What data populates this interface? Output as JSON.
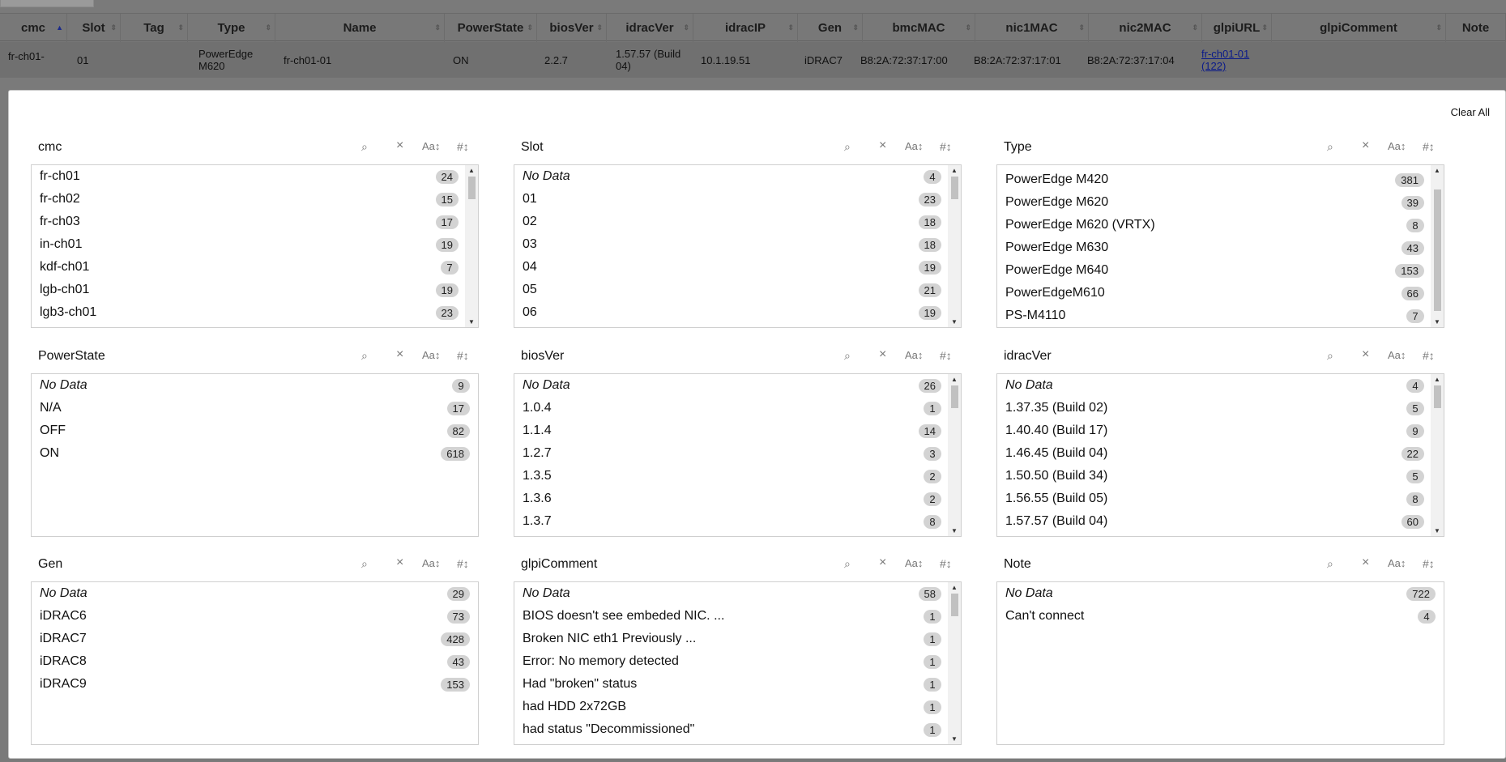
{
  "background_table": {
    "headers": [
      "cmc",
      "Slot",
      "Tag",
      "Type",
      "Name",
      "PowerState",
      "biosVer",
      "idracVer",
      "idracIP",
      "Gen",
      "bmcMAC",
      "nic1MAC",
      "nic2MAC",
      "glpiURL",
      "glpiComment",
      "Note"
    ],
    "sort_up_glyph": "▲",
    "sort_glyph": "⇕",
    "row": {
      "cmc": "fr-ch01-",
      "slot": "01",
      "tag": "",
      "type": "PowerEdge M620",
      "name": "fr-ch01-01",
      "powerstate": "ON",
      "biosver": "2.2.7",
      "idracver": "1.57.57 (Build 04)",
      "idracip": "10.1.19.51",
      "gen": "iDRAC7",
      "bmcmac": "B8:2A:72:37:17:00",
      "nic1mac": "B8:2A:72:37:17:01",
      "nic2mac": "B8:2A:72:37:17:04",
      "glpiurl": "fr-ch01-01 (122)",
      "glpicomment": "",
      "note": ""
    }
  },
  "modal": {
    "clear_all": "Clear All",
    "controls": {
      "search": "⌕",
      "clear": "×",
      "alpha_sort": "Aa↕",
      "num_sort": "#↕"
    },
    "scroll_up": "▲",
    "scroll_down": "▼",
    "panels": [
      {
        "title": "cmc",
        "has_scroll": true,
        "items": [
          {
            "label": "fr-ch01",
            "count": "24"
          },
          {
            "label": "fr-ch02",
            "count": "15"
          },
          {
            "label": "fr-ch03",
            "count": "17"
          },
          {
            "label": "in-ch01",
            "count": "19"
          },
          {
            "label": "kdf-ch01",
            "count": "7"
          },
          {
            "label": "lgb-ch01",
            "count": "19"
          },
          {
            "label": "lgb3-ch01",
            "count": "23"
          }
        ]
      },
      {
        "title": "Slot",
        "has_scroll": true,
        "items": [
          {
            "label": "No Data",
            "count": "4",
            "nodata": true
          },
          {
            "label": "01",
            "count": "23"
          },
          {
            "label": "02",
            "count": "18"
          },
          {
            "label": "03",
            "count": "18"
          },
          {
            "label": "04",
            "count": "19"
          },
          {
            "label": "05",
            "count": "21"
          },
          {
            "label": "06",
            "count": "19"
          }
        ]
      },
      {
        "title": "Type",
        "has_scroll": true,
        "items": [
          {
            "label": "PowerEdge M420",
            "count": "381"
          },
          {
            "label": "PowerEdge M620",
            "count": "39"
          },
          {
            "label": "PowerEdge M620 (VRTX)",
            "count": "8"
          },
          {
            "label": "PowerEdge M630",
            "count": "43"
          },
          {
            "label": "PowerEdge M640",
            "count": "153"
          },
          {
            "label": "PowerEdgeM610",
            "count": "66"
          },
          {
            "label": "PS-M4110",
            "count": "7"
          }
        ]
      },
      {
        "title": "PowerState",
        "has_scroll": false,
        "items": [
          {
            "label": "No Data",
            "count": "9",
            "nodata": true
          },
          {
            "label": "N/A",
            "count": "17"
          },
          {
            "label": "OFF",
            "count": "82"
          },
          {
            "label": "ON",
            "count": "618"
          }
        ]
      },
      {
        "title": "biosVer",
        "has_scroll": true,
        "items": [
          {
            "label": "No Data",
            "count": "26",
            "nodata": true
          },
          {
            "label": "1.0.4",
            "count": "1"
          },
          {
            "label": "1.1.4",
            "count": "14"
          },
          {
            "label": "1.2.7",
            "count": "3"
          },
          {
            "label": "1.3.5",
            "count": "2"
          },
          {
            "label": "1.3.6",
            "count": "2"
          },
          {
            "label": "1.3.7",
            "count": "8"
          }
        ]
      },
      {
        "title": "idracVer",
        "has_scroll": true,
        "items": [
          {
            "label": "No Data",
            "count": "4",
            "nodata": true
          },
          {
            "label": "1.37.35 (Build 02)",
            "count": "5"
          },
          {
            "label": "1.40.40 (Build 17)",
            "count": "9"
          },
          {
            "label": "1.46.45 (Build 04)",
            "count": "22"
          },
          {
            "label": "1.50.50 (Build 34)",
            "count": "5"
          },
          {
            "label": "1.56.55 (Build 05)",
            "count": "8"
          },
          {
            "label": "1.57.57 (Build 04)",
            "count": "60"
          }
        ]
      },
      {
        "title": "Gen",
        "has_scroll": false,
        "items": [
          {
            "label": "No Data",
            "count": "29",
            "nodata": true
          },
          {
            "label": "iDRAC6",
            "count": "73"
          },
          {
            "label": "iDRAC7",
            "count": "428"
          },
          {
            "label": "iDRAC8",
            "count": "43"
          },
          {
            "label": "iDRAC9",
            "count": "153"
          }
        ]
      },
      {
        "title": "glpiComment",
        "has_scroll": true,
        "items": [
          {
            "label": "No Data",
            "count": "58",
            "nodata": true
          },
          {
            "label": "BIOS doesn't see embeded NIC. ...",
            "count": "1"
          },
          {
            "label": "Broken NIC eth1 Previously ...",
            "count": "1"
          },
          {
            "label": "Error: No memory detected",
            "count": "1"
          },
          {
            "label": "Had \"broken\" status",
            "count": "1"
          },
          {
            "label": "had HDD 2x72GB",
            "count": "1"
          },
          {
            "label": "had status \"Decommissioned\"",
            "count": "1"
          }
        ]
      },
      {
        "title": "Note",
        "has_scroll": false,
        "items": [
          {
            "label": "No Data",
            "count": "722",
            "nodata": true
          },
          {
            "label": "Can't connect",
            "count": "4"
          }
        ]
      }
    ]
  }
}
